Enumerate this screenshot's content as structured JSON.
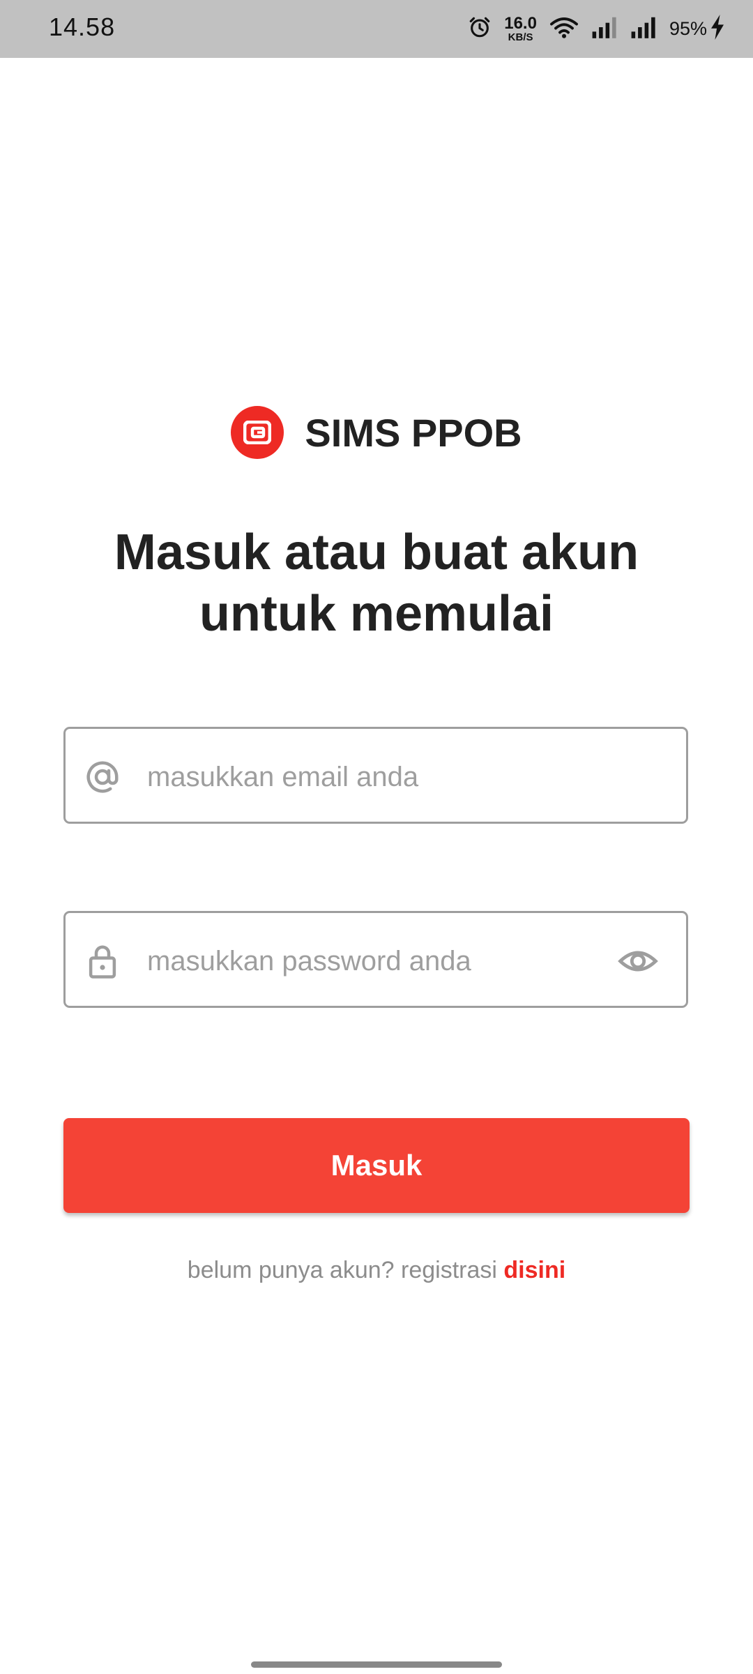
{
  "status_bar": {
    "time": "14.58",
    "net_speed_value": "16.0",
    "net_speed_unit": "KB/S",
    "battery": "95%",
    "icons": [
      "alarm-icon",
      "wifi-icon",
      "signal-icon",
      "signal-icon",
      "charging-icon"
    ]
  },
  "brand": {
    "name": "SIMS PPOB",
    "logo_icon": "wallet-icon",
    "color": "#ee2a24"
  },
  "headline": {
    "line1": "Masuk atau buat akun",
    "line2": "untuk memulai"
  },
  "form": {
    "email": {
      "icon": "at-icon",
      "value": "",
      "placeholder": "masukkan email anda"
    },
    "password": {
      "icon": "lock-icon",
      "value": "",
      "placeholder": "masukkan password anda",
      "toggle_icon": "eye-icon"
    },
    "submit_label": "Masuk"
  },
  "register": {
    "prompt": "belum punya akun? registrasi",
    "link_label": "disini"
  },
  "colors": {
    "accent": "#f44336",
    "brand_red": "#ee2a24",
    "status_bar": "#c1c1c1",
    "field_border": "#9e9e9e",
    "placeholder": "#9e9e9e"
  }
}
